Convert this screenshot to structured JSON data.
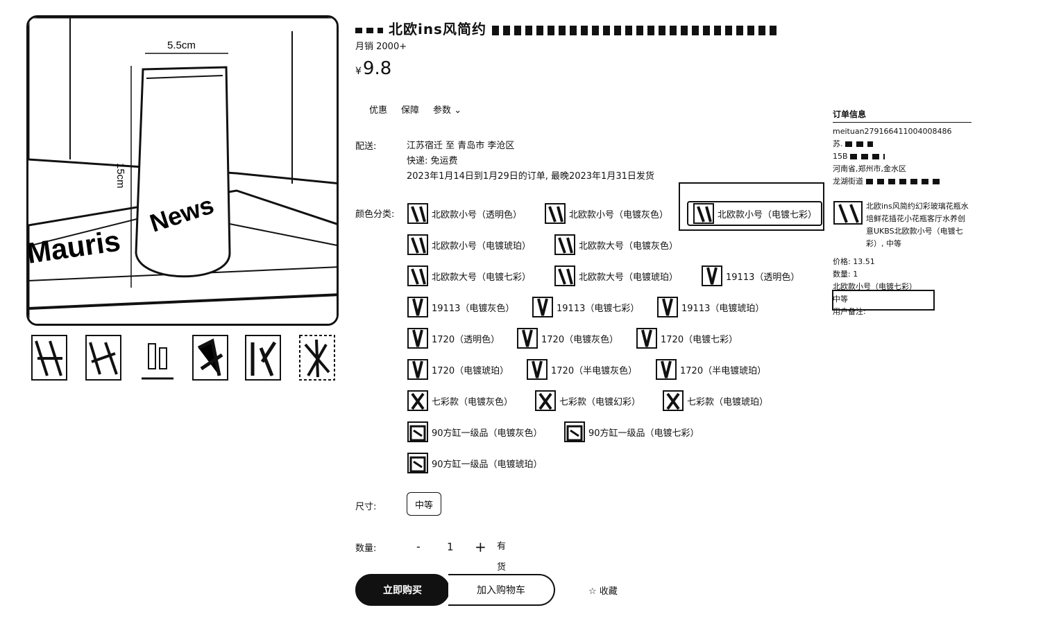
{
  "product": {
    "title": "北欧ins风简约",
    "sales": "月销 2000+",
    "currency": "¥",
    "price": "9.8",
    "image_dims": {
      "width_label": "5.5cm",
      "height_label": "15cm",
      "newspaper_text": "Mauris",
      "newspaper_text2": "News"
    }
  },
  "tabs": [
    "优惠",
    "保障",
    "参数"
  ],
  "shipping": {
    "label": "配送:",
    "route": "江苏宿迁 至 青岛市 李沧区",
    "fee": "快递: 免运费",
    "eta": "2023年1月14日到1月29日的订单, 最晚2023年1月31日发货"
  },
  "variants_label": "颜色分类:",
  "variants": [
    [
      "北欧款小号（透明色）",
      "北欧款小号（电镀灰色）",
      "北欧款小号（电镀七彩）"
    ],
    [
      "北欧款小号（电镀琥珀）",
      "北欧款大号（电镀灰色）"
    ],
    [
      "北欧款大号（电镀七彩）",
      "北欧款大号（电镀琥珀）",
      "19113（透明色）"
    ],
    [
      "19113（电镀灰色）",
      "19113（电镀七彩）",
      "19113（电镀琥珀）"
    ],
    [
      "1720（透明色）",
      "1720（电镀灰色）",
      "1720（电镀七彩）"
    ],
    [
      "1720（电镀琥珀）",
      "1720（半电镀灰色）",
      "1720（半电镀琥珀）"
    ],
    [
      "七彩款（电镀灰色）",
      "七彩款（电镀幻彩）",
      "七彩款（电镀琥珀）"
    ],
    [
      "90方缸一级品（电镀灰色）",
      "90方缸一级品（电镀七彩）"
    ],
    [
      "90方缸一级品（电镀琥珀）"
    ]
  ],
  "size": {
    "label": "尺寸:",
    "value": "中等"
  },
  "quantity": {
    "label": "数量:",
    "minus": "-",
    "value": "1",
    "plus": "+",
    "stock": "有货"
  },
  "actions": {
    "buy": "立即购买",
    "cart": "加入购物车",
    "fav": "收藏"
  },
  "order_info": {
    "title": "订单信息",
    "order_no": "meituan279166411004008486",
    "name": "苏.",
    "phone": "15B",
    "addr1": "河南省,郑州市,金水区",
    "addr2": "龙湖街道",
    "item_title": "北欧ins风简约幻彩玻璃花瓶水培鲜花插花小花瓶客厅水养创意UKBS北欧款小号（电镀七彩）, 中等",
    "price": "价格: 13.51",
    "qty": "数量: 1",
    "spec": "北欧款小号（电镀七彩）",
    "size": "中等",
    "remark": "用户备注:"
  }
}
